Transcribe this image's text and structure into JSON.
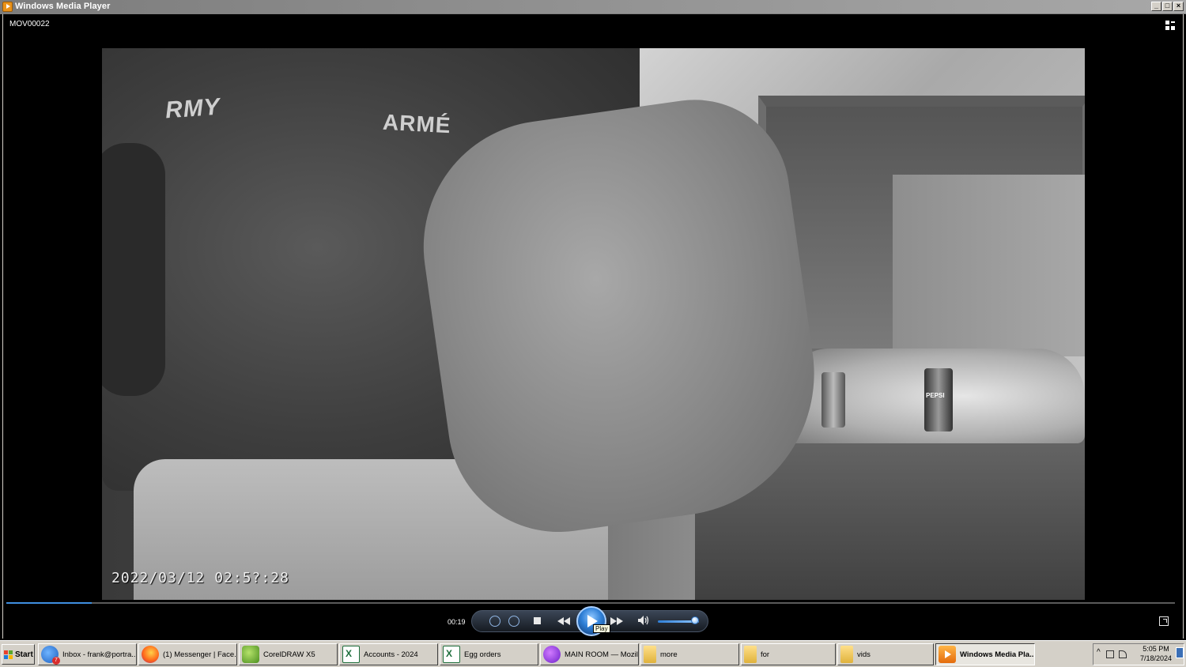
{
  "window": {
    "title": "Windows Media Player",
    "controls": [
      "_",
      "□",
      "×"
    ]
  },
  "player": {
    "media_title": "MOV00022",
    "video_timestamp": "2022/03/12 02:5?:28",
    "video_text_1": "RMY",
    "video_text_2": "ARMÉ",
    "video_text_3": "PEPSI",
    "elapsed": "00:19",
    "seek_progress": 0.073,
    "volume_level": 0.9,
    "play_tooltip": "Play",
    "accent_color": "#2f7fd6"
  },
  "taskbar": {
    "start_label": "Start",
    "tasks": [
      {
        "label": "Inbox - frank@portra...",
        "icon": "thunderbird-icon"
      },
      {
        "label": "(1) Messenger | Face...",
        "icon": "firefox-icon"
      },
      {
        "label": "CorelDRAW X5",
        "icon": "coreldraw-icon"
      },
      {
        "label": "Accounts - 2024",
        "icon": "excel-icon"
      },
      {
        "label": "Egg orders",
        "icon": "excel-icon"
      },
      {
        "label": "MAIN ROOM — Mozil...",
        "icon": "messenger-icon"
      },
      {
        "label": "more",
        "icon": "folder-icon"
      },
      {
        "label": "for",
        "icon": "folder-icon"
      },
      {
        "label": "vids",
        "icon": "folder-icon"
      },
      {
        "label": "Windows Media Pla...",
        "icon": "wmp-icon"
      }
    ],
    "clock_time": "5:05 PM",
    "clock_date": "7/18/2024"
  }
}
